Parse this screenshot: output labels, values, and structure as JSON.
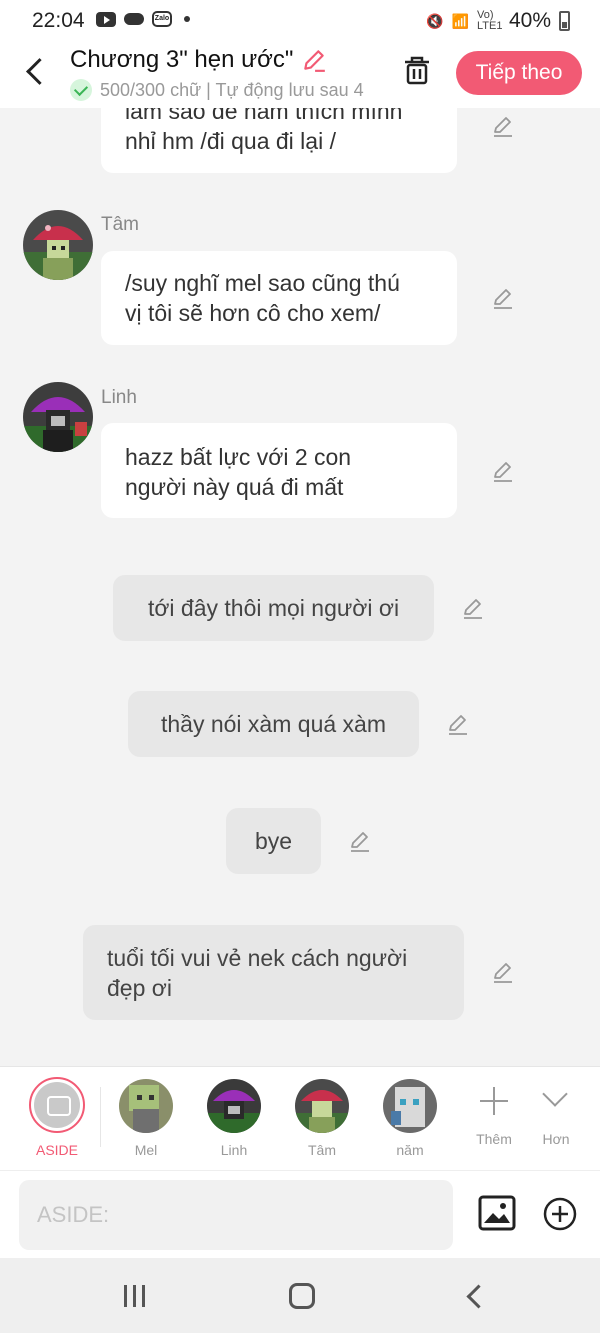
{
  "status_bar": {
    "time": "22:04",
    "battery": "40%",
    "network": "Vo) LTE1"
  },
  "header": {
    "title": "Chương 3\" hẹn ước\"",
    "subtitle": "500/300 chữ | Tự động lưu sau 4",
    "next_label": "Tiếp theo"
  },
  "messages": [
    {
      "type": "character",
      "name": "",
      "text_lines": [
        "làm sao để nam thích mình",
        "nhỉ hm /đi qua đi lại /"
      ]
    },
    {
      "type": "character",
      "name": "Tâm",
      "text_lines": [
        "/suy nghĩ mel sao cũng thú",
        "vị tôi sẽ hơn cô cho xem/"
      ]
    },
    {
      "type": "character",
      "name": "Linh",
      "text_lines": [
        "hazz bất lực với 2 con",
        "người này quá đi mất"
      ]
    },
    {
      "type": "aside",
      "text": "tới đây thôi mọi người ơi"
    },
    {
      "type": "aside",
      "text": "thầy nói xàm quá xàm"
    },
    {
      "type": "aside",
      "text": "bye"
    },
    {
      "type": "aside",
      "text_lines": [
        "tuổi tối vui vẻ nek cách người",
        "đẹp ơi"
      ]
    }
  ],
  "character_bar": {
    "aside_label": "ASIDE",
    "characters": [
      "Mel",
      "Linh",
      "Tâm",
      "năm"
    ],
    "more_label": "Thêm",
    "collapse_label": "Hơn"
  },
  "input": {
    "placeholder": "ASIDE:"
  },
  "colors": {
    "accent": "#f25a74",
    "check_green": "#3bb556",
    "bubble_white": "#ffffff",
    "bubble_grey": "#e7e7e7"
  }
}
